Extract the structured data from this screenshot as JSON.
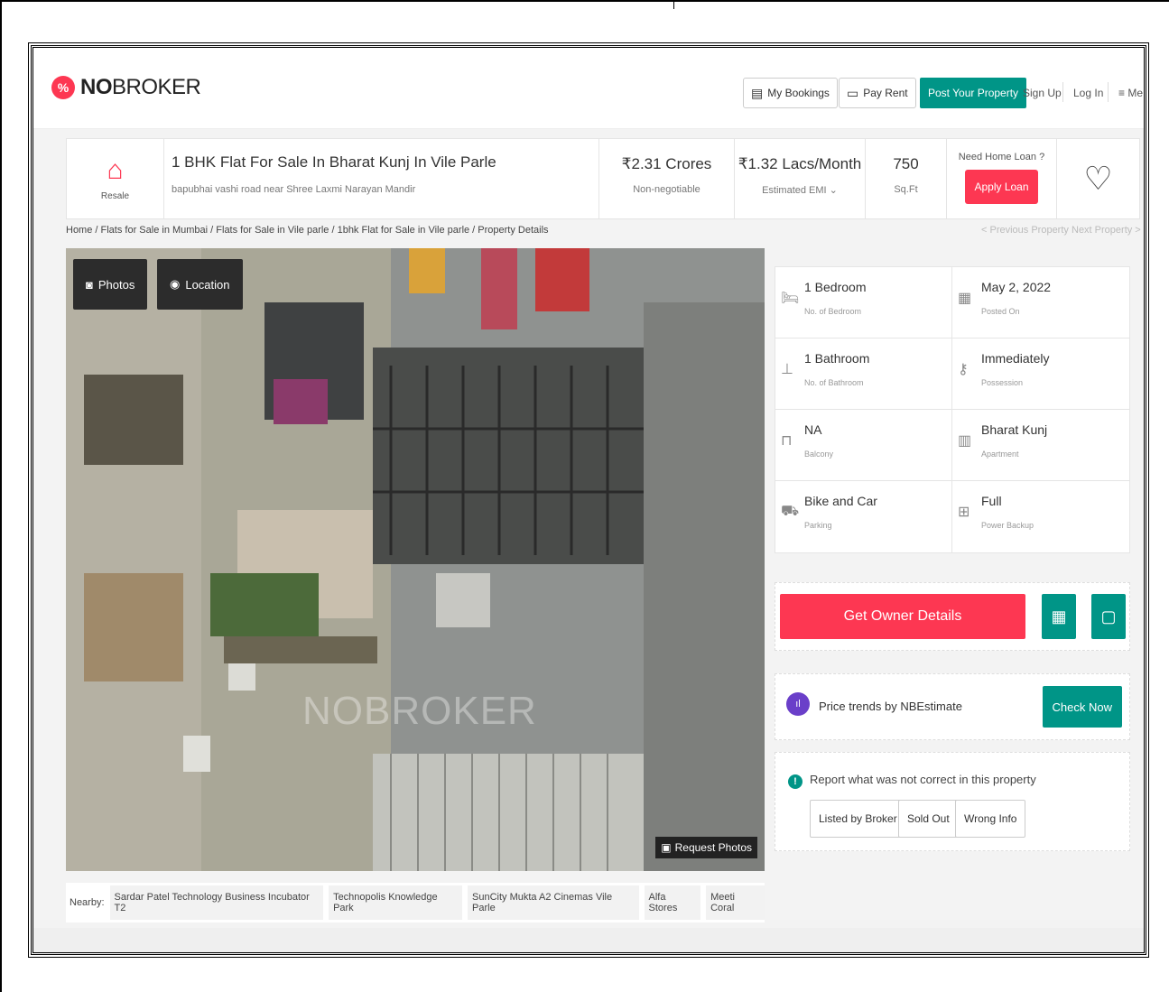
{
  "header": {
    "logo_bold": "NO",
    "logo_light": "BROKER",
    "my_bookings": "My Bookings",
    "pay_rent": "Pay Rent",
    "post_property": "Post Your Property",
    "sign_up": "Sign Up",
    "log_in": "Log In",
    "menu": "Me"
  },
  "summary": {
    "resale_label": "Resale",
    "title": "1 BHK Flat For Sale In Bharat Kunj In Vile Parle",
    "address": "bapubhai vashi road near Shree Laxmi Narayan Mandir",
    "price": "₹2.31 Crores",
    "price_note": "Non-negotiable",
    "emi": "₹1.32 Lacs/Month",
    "emi_note": "Estimated EMI ⌄",
    "area": "750",
    "area_unit": "Sq.Ft",
    "loan_question": "Need Home Loan ?",
    "loan_button": "Apply Loan"
  },
  "breadcrumb": "Home / Flats for Sale in Mumbai / Flats for Sale in Vile parle / 1bhk Flat for Sale in Vile parle / Property Details",
  "nav": {
    "previous": "< Previous Property",
    "next": "Next Property >"
  },
  "photo": {
    "photos_btn": "Photos",
    "location_btn": "Location",
    "request_photos": "Request Photos",
    "watermark": "NOBROKER"
  },
  "nearby": {
    "label": "Nearby:",
    "places": [
      "Sardar Patel Technology Business Incubator T2",
      "Technopolis Knowledge Park",
      "SunCity Mukta A2 Cinemas Vile Parle",
      "Alfa Stores",
      "Meeti Coral"
    ]
  },
  "details": [
    {
      "value": "1 Bedroom",
      "label": "No. of Bedroom",
      "icon": "bed-icon"
    },
    {
      "value": "May 2, 2022",
      "label": "Posted On",
      "icon": "calendar-icon"
    },
    {
      "value": "1 Bathroom",
      "label": "No. of Bathroom",
      "icon": "bathtub-icon"
    },
    {
      "value": "Immediately",
      "label": "Possession",
      "icon": "key-icon"
    },
    {
      "value": "NA",
      "label": "Balcony",
      "icon": "balcony-icon"
    },
    {
      "value": "Bharat Kunj",
      "label": "Apartment",
      "icon": "building-icon"
    },
    {
      "value": "Bike and Car",
      "label": "Parking",
      "icon": "car-icon"
    },
    {
      "value": "Full",
      "label": "Power Backup",
      "icon": "battery-icon"
    }
  ],
  "actions": {
    "owner_details": "Get Owner Details"
  },
  "trend": {
    "text": "Price trends by NBEstimate",
    "button": "Check Now"
  },
  "report": {
    "text": "Report what was not correct in this property",
    "buttons": [
      "Listed by Broker",
      "Sold Out",
      "Wrong Info"
    ]
  },
  "colors": {
    "brand_red": "#fd3752",
    "brand_green": "#009587"
  }
}
